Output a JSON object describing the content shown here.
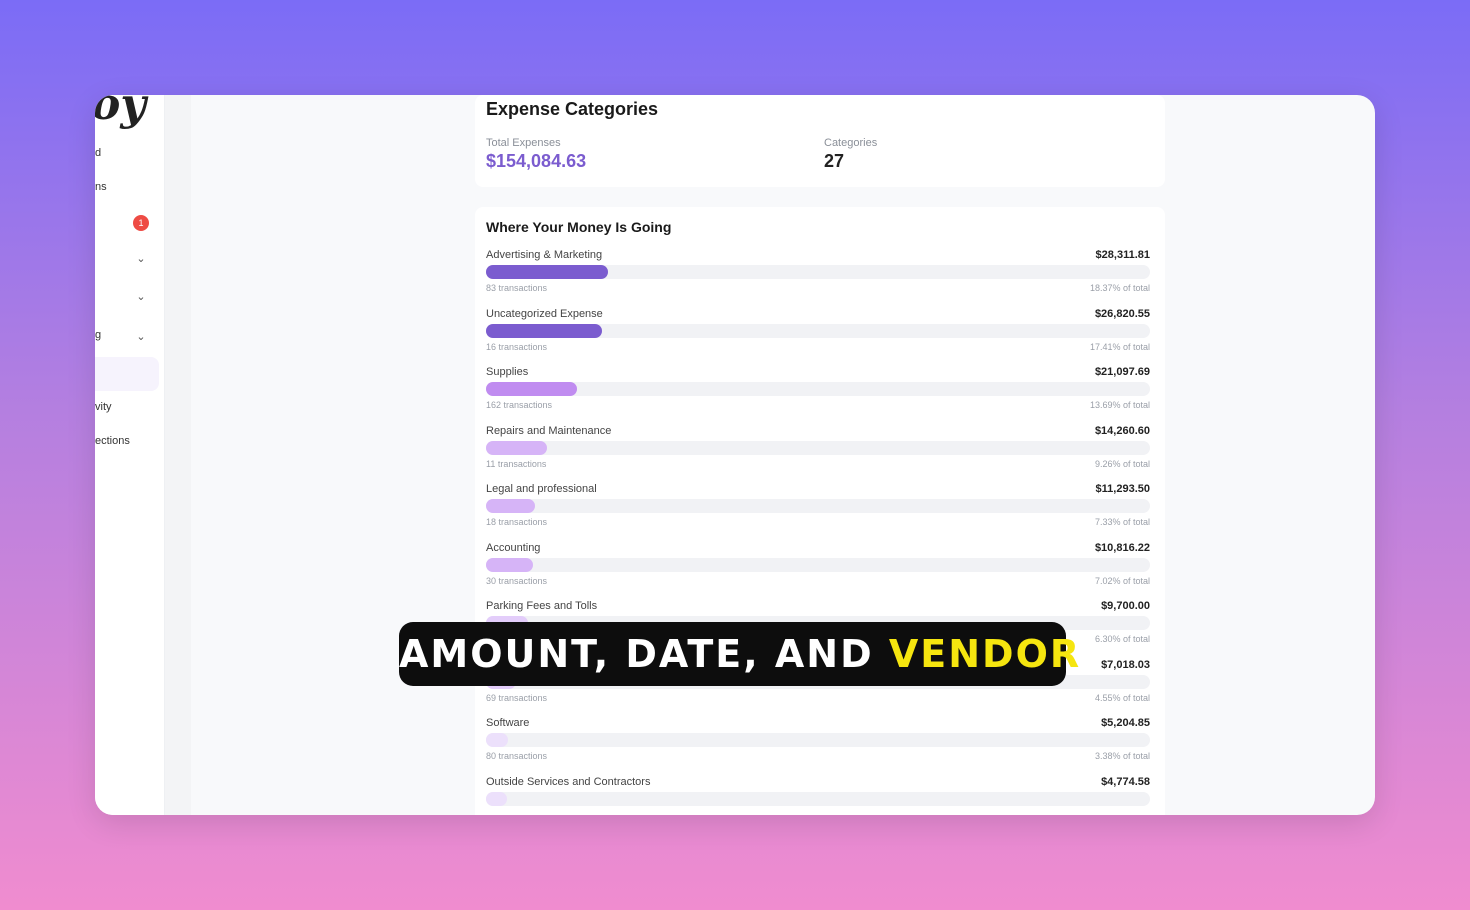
{
  "app": {
    "logo_text": "oy"
  },
  "sidebar": {
    "items": [
      {
        "label": "d",
        "has_badge": false,
        "has_chevron": false
      },
      {
        "label": "ns",
        "has_badge": false,
        "has_chevron": false
      },
      {
        "label": "",
        "badge": "1",
        "has_badge": true,
        "has_chevron": false
      },
      {
        "label": "",
        "has_badge": false,
        "has_chevron": true
      },
      {
        "label": "",
        "has_badge": false,
        "has_chevron": true
      },
      {
        "label": "g",
        "has_badge": false,
        "has_chevron": true
      },
      {
        "label": "",
        "has_badge": false,
        "has_chevron": false,
        "active": true
      },
      {
        "label": "vity",
        "has_badge": false,
        "has_chevron": false
      },
      {
        "label": "ections",
        "has_badge": false,
        "has_chevron": false
      }
    ],
    "badge_color": "#ee4b44"
  },
  "summary": {
    "title": "Expense Categories",
    "total_label": "Total Expenses",
    "total_value": "$154,084.63",
    "categories_label": "Categories",
    "categories_value": "27",
    "accent_color": "#7b5ccf"
  },
  "breakdown": {
    "title": "Where Your Money Is Going",
    "rows": [
      {
        "name": "Advertising & Marketing",
        "amount": "$28,311.81",
        "transactions": "83 transactions",
        "pct_label": "18.37% of total",
        "share": 0.1837,
        "color": "#7b5ccf"
      },
      {
        "name": "Uncategorized Expense",
        "amount": "$26,820.55",
        "transactions": "16 transactions",
        "pct_label": "17.41% of total",
        "share": 0.1741,
        "color": "#7b5ccf"
      },
      {
        "name": "Supplies",
        "amount": "$21,097.69",
        "transactions": "162 transactions",
        "pct_label": "13.69% of total",
        "share": 0.1369,
        "color": "#c08cf0"
      },
      {
        "name": "Repairs and Maintenance",
        "amount": "$14,260.60",
        "transactions": "11 transactions",
        "pct_label": "9.26% of total",
        "share": 0.0926,
        "color": "#d6b4f7"
      },
      {
        "name": "Legal and professional",
        "amount": "$11,293.50",
        "transactions": "18 transactions",
        "pct_label": "7.33% of total",
        "share": 0.0733,
        "color": "#d6b4f7"
      },
      {
        "name": "Accounting",
        "amount": "$10,816.22",
        "transactions": "30 transactions",
        "pct_label": "7.02% of total",
        "share": 0.0702,
        "color": "#d6b4f7"
      },
      {
        "name": "Parking Fees and Tolls",
        "amount": "$9,700.00",
        "transactions": "",
        "pct_label": "6.30% of total",
        "share": 0.063,
        "color": "#e3cdfa"
      },
      {
        "name": "",
        "amount": "$7,018.03",
        "transactions": "69 transactions",
        "pct_label": "4.55% of total",
        "share": 0.0455,
        "color": "#e3cdfa"
      },
      {
        "name": "Software",
        "amount": "$5,204.85",
        "transactions": "80 transactions",
        "pct_label": "3.38% of total",
        "share": 0.0338,
        "color": "#ece0fb"
      },
      {
        "name": "Outside Services and Contractors",
        "amount": "$4,774.58",
        "transactions": "",
        "pct_label": "",
        "share": 0.031,
        "color": "#ece0fb"
      }
    ]
  },
  "caption": {
    "text_main": "AMOUNT, DATE, AND ",
    "text_highlight": "VENDOR",
    "highlight_color": "#f5e50f"
  }
}
